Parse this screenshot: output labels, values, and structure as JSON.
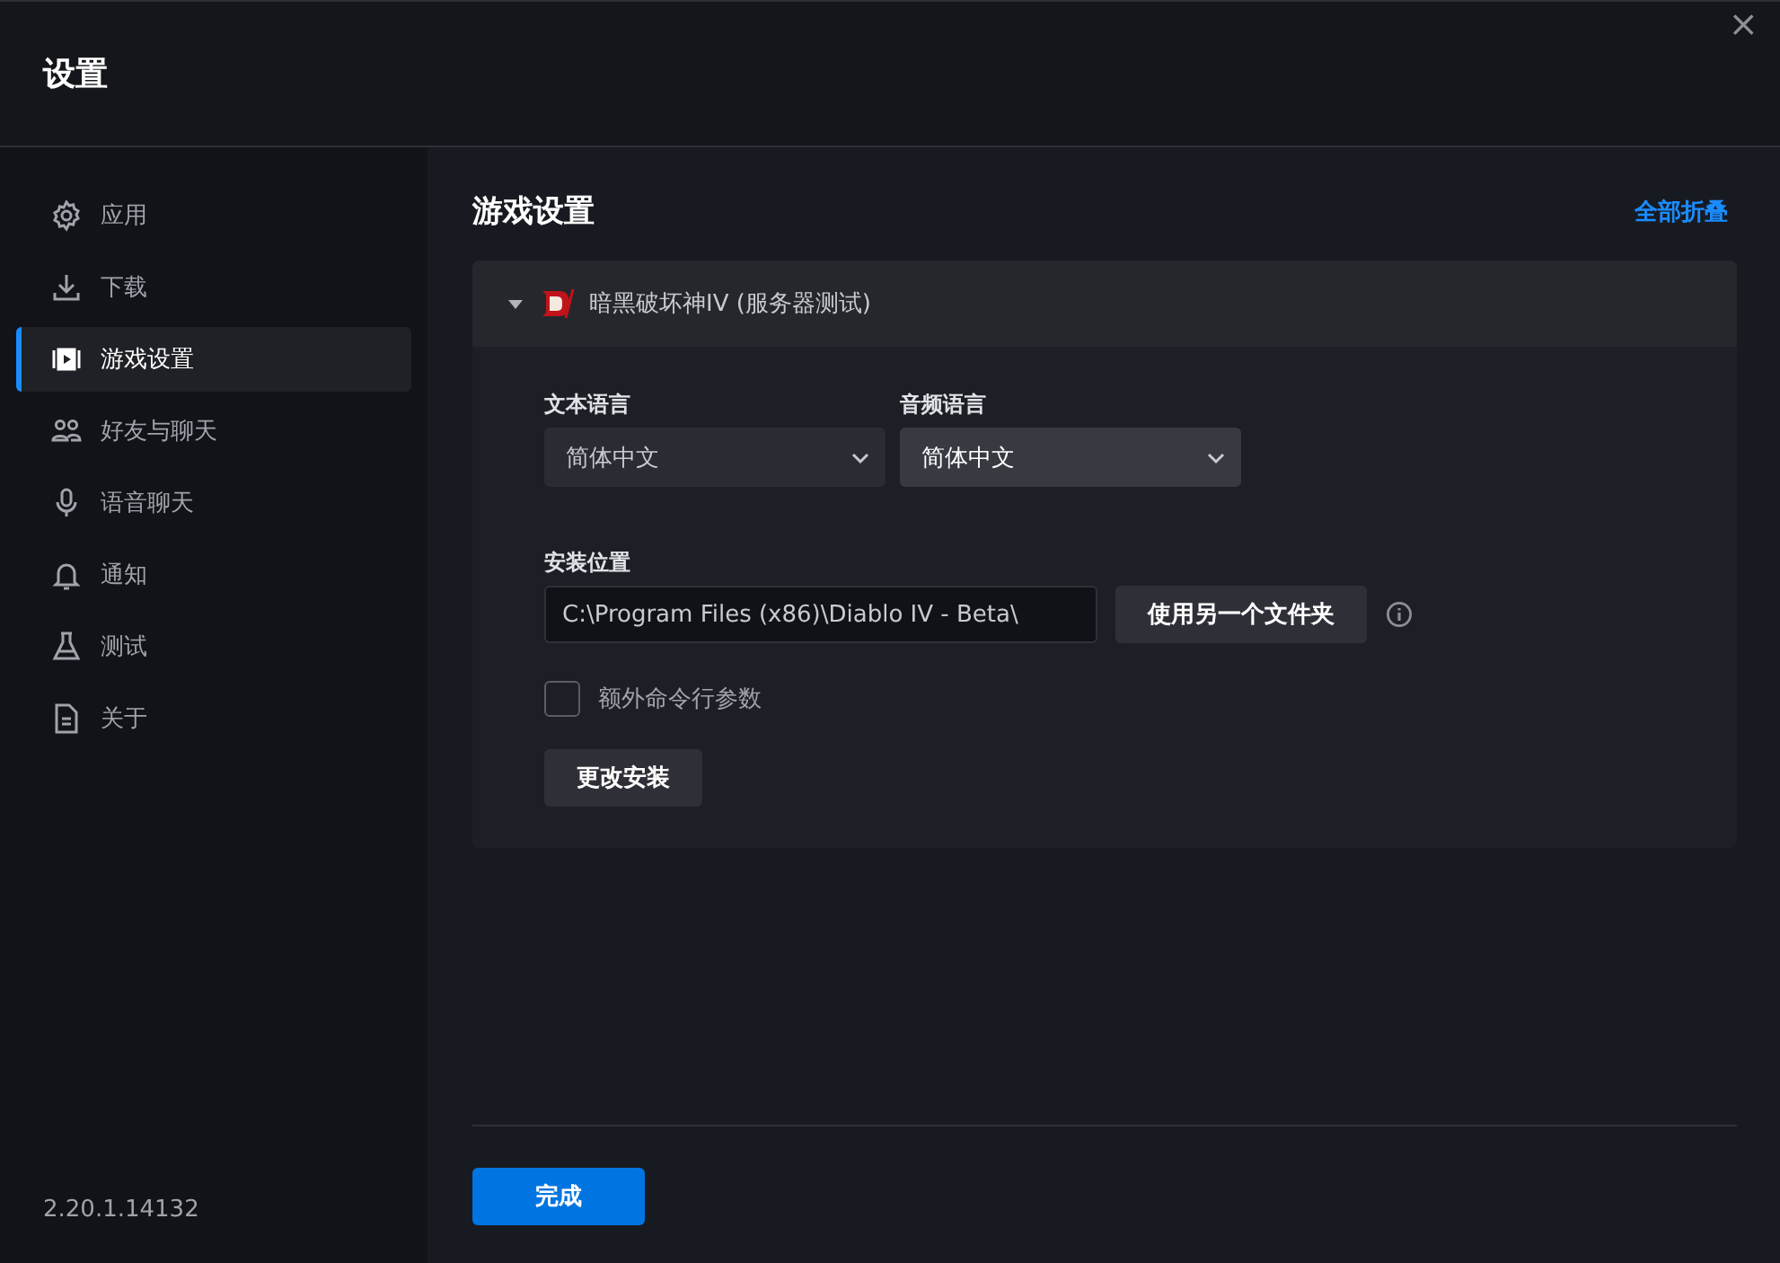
{
  "window": {
    "title": "设置",
    "close": "×"
  },
  "sidebar": {
    "items": [
      {
        "label": "应用",
        "selected": false
      },
      {
        "label": "下载",
        "selected": false
      },
      {
        "label": "游戏设置",
        "selected": true
      },
      {
        "label": "好友与聊天",
        "selected": false
      },
      {
        "label": "语音聊天",
        "selected": false
      },
      {
        "label": "通知",
        "selected": false
      },
      {
        "label": "测试",
        "selected": false
      },
      {
        "label": "关于",
        "selected": false
      }
    ],
    "version": "2.20.1.14132"
  },
  "main": {
    "title": "游戏设置",
    "collapse_all": "全部折叠",
    "game": {
      "name": "暗黑破坏神IV (服务器测试)",
      "expanded": true,
      "selects": [
        {
          "label": "文本语言",
          "value": "简体中文",
          "focused": false
        },
        {
          "label": "音频语言",
          "value": "简体中文",
          "focused": true
        }
      ],
      "install_label": "安装位置",
      "install_path": "C:\\Program Files (x86)\\Diablo IV - Beta\\",
      "other_folder": "使用另一个文件夹",
      "extra_args": {
        "label": "额外命令行参数",
        "checked": false
      },
      "change_install": "更改安装"
    },
    "done": "完成"
  }
}
